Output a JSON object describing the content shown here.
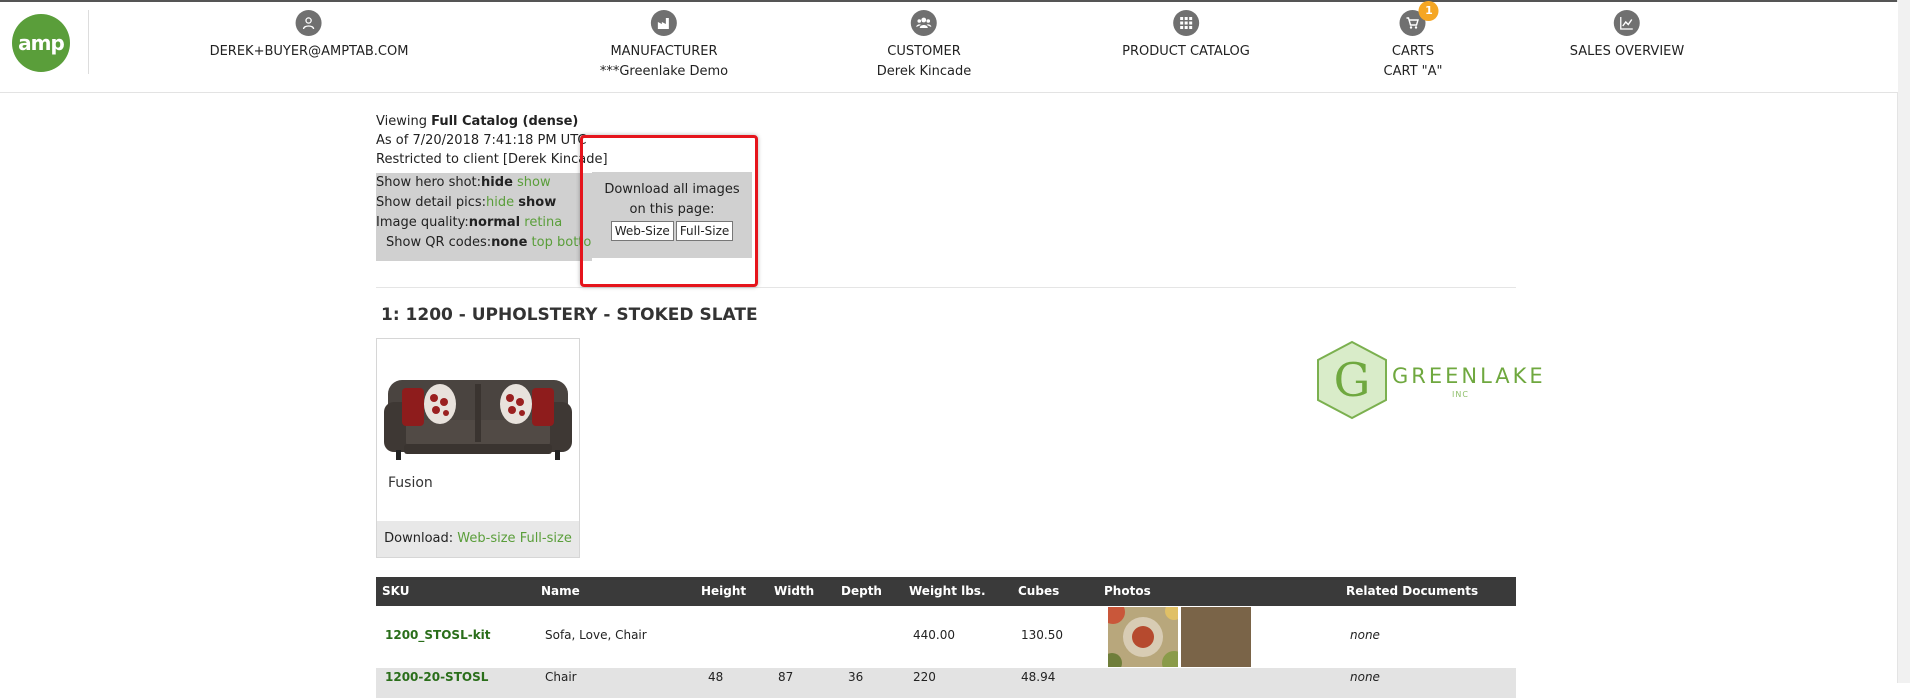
{
  "header": {
    "logo_text": "amp",
    "nav": [
      {
        "key": "user",
        "icon": "user-icon",
        "label": "DEREK+BUYER@AMPTAB.COM",
        "sub": ""
      },
      {
        "key": "manufacturer",
        "icon": "factory-icon",
        "label": "MANUFACTURER",
        "sub": "***Greenlake Demo"
      },
      {
        "key": "customer",
        "icon": "users-icon",
        "label": "CUSTOMER",
        "sub": "Derek Kincade"
      },
      {
        "key": "catalog",
        "icon": "grid-icon",
        "label": "PRODUCT CATALOG",
        "sub": ""
      },
      {
        "key": "carts",
        "icon": "cart-icon",
        "label": "CARTS",
        "sub": "CART \"A\"",
        "badge": "1"
      },
      {
        "key": "sales",
        "icon": "chart-icon",
        "label": "SALES OVERVIEW",
        "sub": ""
      }
    ]
  },
  "catalog": {
    "viewing_prefix": "Viewing ",
    "viewing_name": "Full Catalog (dense)",
    "as_of": "As of 7/20/2018 7:41:18 PM UTC",
    "restricted": "Restricted to client [Derek Kincade]"
  },
  "toggles": {
    "hero": {
      "label": "Show hero shot:",
      "opt1": "hide",
      "opt2": "show"
    },
    "detail": {
      "label": "Show detail pics:",
      "opt1": "hide",
      "opt2": "show"
    },
    "quality": {
      "label": "Image quality:",
      "opt1": "normal",
      "opt2": "retina"
    },
    "qr": {
      "label": "Show QR codes:",
      "opt1": "none",
      "opt2": "top",
      "opt3": "bottom"
    }
  },
  "download_all": {
    "line1": "Download all images",
    "line2": "on this page:",
    "web_btn": "Web-Size",
    "full_btn": "Full-Size"
  },
  "product": {
    "title": "1: 1200 - UPHOLSTERY - STOKED SLATE",
    "download_label": "Download:",
    "web_link": "Web-size",
    "full_link": "Full-size",
    "brand_mark": "Fusion",
    "manufacturer_logo_text": "GREENLAKE",
    "manufacturer_logo_sub": "INC",
    "manufacturer_logo_letter": "G"
  },
  "table": {
    "headers": [
      "SKU",
      "Name",
      "Height",
      "Width",
      "Depth",
      "Weight lbs.",
      "Cubes",
      "Photos",
      "Related Documents"
    ],
    "rows": [
      {
        "sku": "1200_STOSL-kit",
        "name": "Sofa, Love, Chair",
        "height": "",
        "width": "",
        "depth": "",
        "weight": "440.00",
        "cubes": "130.50",
        "docs": "none"
      },
      {
        "sku": "1200-20-STOSL",
        "name": "Chair",
        "height": "48",
        "width": "87",
        "depth": "36",
        "weight": "220",
        "cubes": "48.94",
        "docs": "none"
      }
    ]
  }
}
